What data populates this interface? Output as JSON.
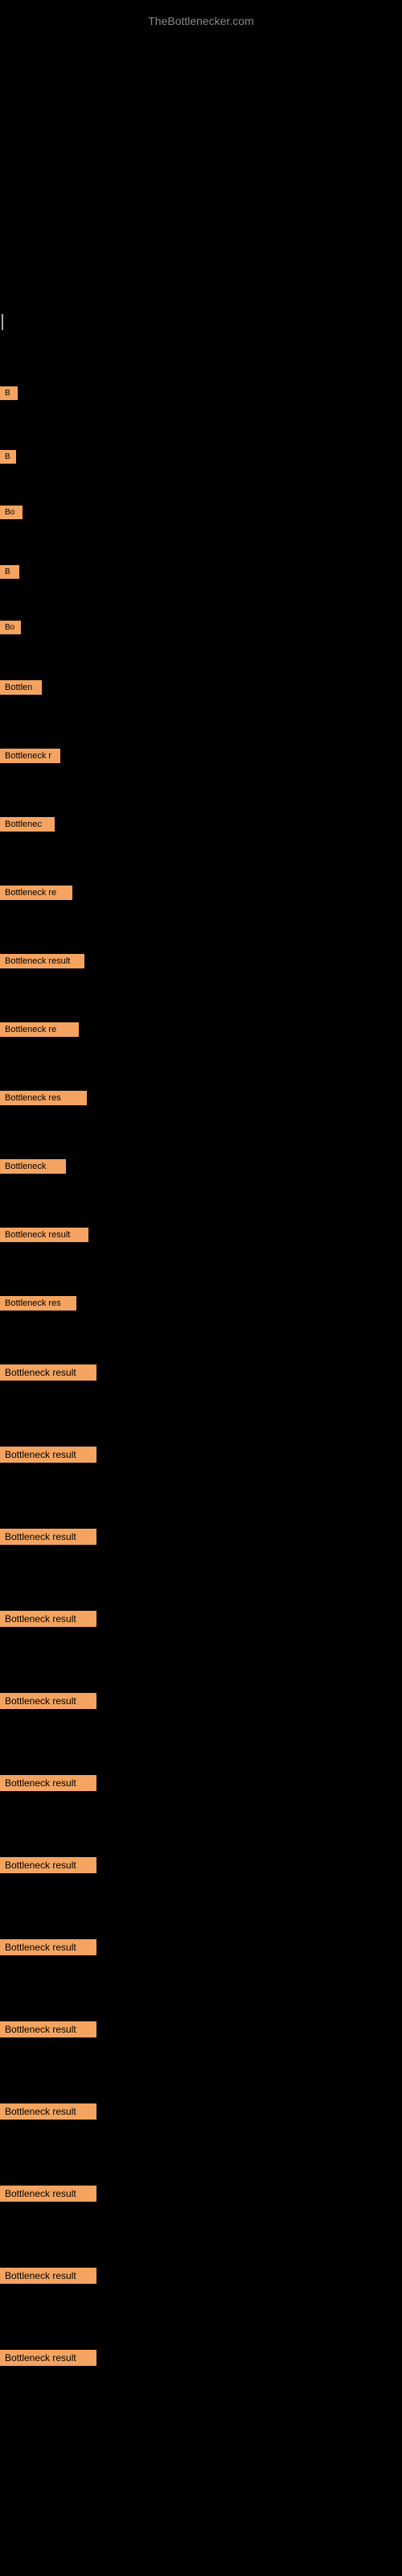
{
  "site": {
    "title": "TheBottlenecker.com"
  },
  "items": [
    {
      "id": 1,
      "label": "B"
    },
    {
      "id": 2,
      "label": "B"
    },
    {
      "id": 3,
      "label": "Bo"
    },
    {
      "id": 4,
      "label": "B"
    },
    {
      "id": 5,
      "label": "Bo"
    },
    {
      "id": 6,
      "label": "Bottlen"
    },
    {
      "id": 7,
      "label": "Bottleneck r"
    },
    {
      "id": 8,
      "label": "Bottlenec"
    },
    {
      "id": 9,
      "label": "Bottleneck re"
    },
    {
      "id": 10,
      "label": "Bottleneck result"
    },
    {
      "id": 11,
      "label": "Bottleneck re"
    },
    {
      "id": 12,
      "label": "Bottleneck res"
    },
    {
      "id": 13,
      "label": "Bottleneck"
    },
    {
      "id": 14,
      "label": "Bottleneck result"
    },
    {
      "id": 15,
      "label": "Bottleneck res"
    },
    {
      "id": 16,
      "label": "Bottleneck result"
    },
    {
      "id": 17,
      "label": "Bottleneck result"
    },
    {
      "id": 18,
      "label": "Bottleneck result"
    },
    {
      "id": 19,
      "label": "Bottleneck result"
    },
    {
      "id": 20,
      "label": "Bottleneck result"
    },
    {
      "id": 21,
      "label": "Bottleneck result"
    },
    {
      "id": 22,
      "label": "Bottleneck result"
    },
    {
      "id": 23,
      "label": "Bottleneck result"
    },
    {
      "id": 24,
      "label": "Bottleneck result"
    },
    {
      "id": 25,
      "label": "Bottleneck result"
    },
    {
      "id": 26,
      "label": "Bottleneck result"
    },
    {
      "id": 27,
      "label": "Bottleneck result"
    },
    {
      "id": 28,
      "label": "Bottleneck result"
    }
  ]
}
